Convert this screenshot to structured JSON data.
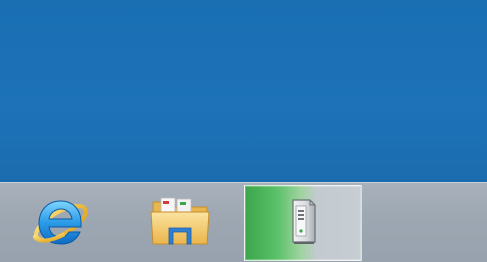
{
  "taskbar": {
    "buttons": [
      {
        "name": "internet-explorer",
        "icon": "internet-explorer-icon",
        "active": false
      },
      {
        "name": "file-explorer",
        "icon": "file-explorer-folder-icon",
        "active": false
      },
      {
        "name": "server-manager",
        "icon": "server-tower-icon",
        "active": true
      }
    ]
  },
  "colors": {
    "desktop_background": "#1d72b8",
    "taskbar_background": "#a0aab5",
    "active_button_highlight": "#3aa64a"
  }
}
